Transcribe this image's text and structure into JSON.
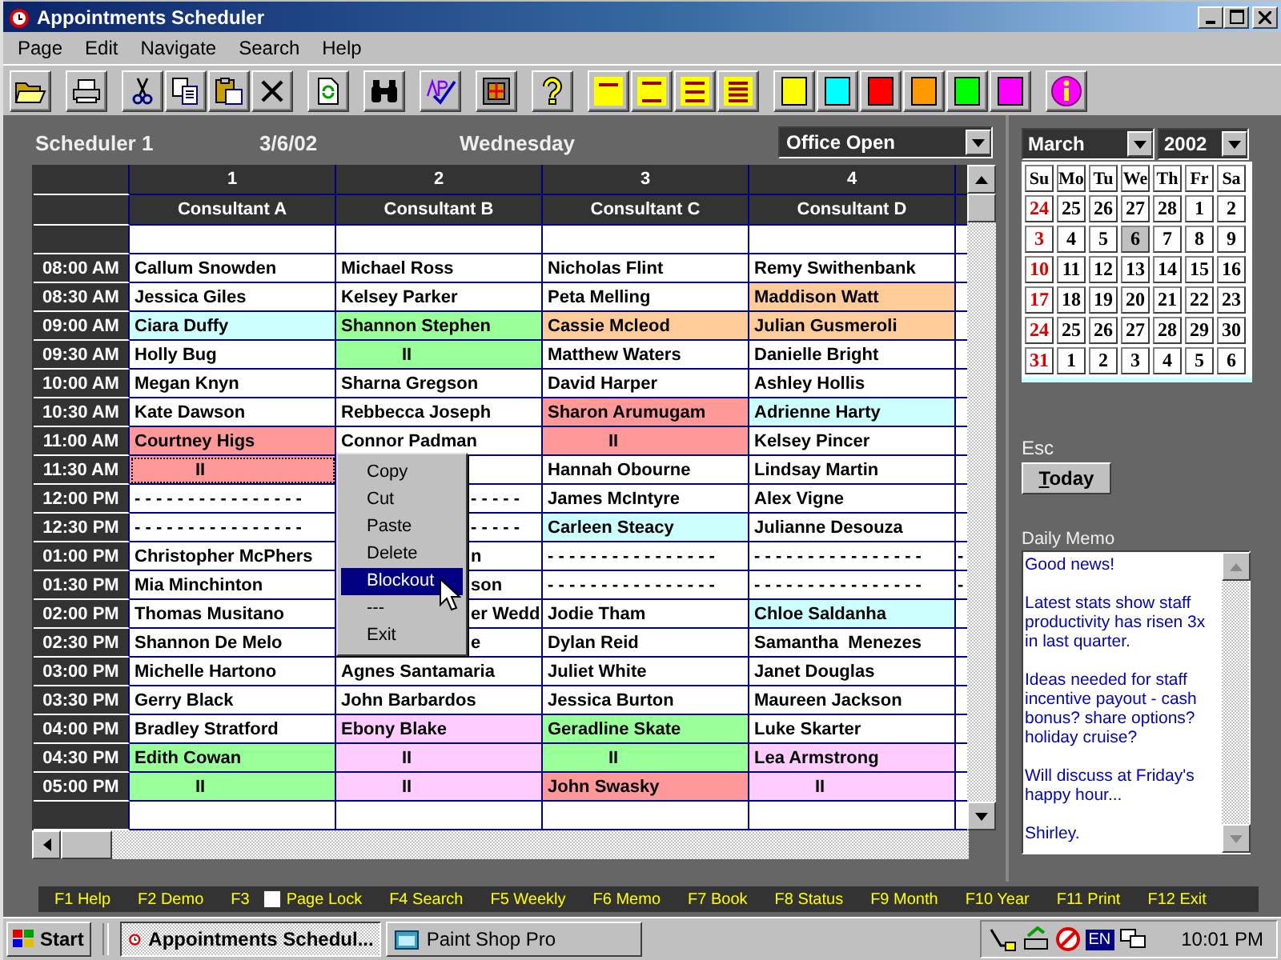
{
  "window": {
    "title": "Appointments Scheduler"
  },
  "menu": [
    "Page",
    "Edit",
    "Navigate",
    "Search",
    "Help"
  ],
  "toolbar": [
    [
      {
        "kind": "open"
      }
    ],
    [
      {
        "kind": "print"
      }
    ],
    [
      {
        "kind": "cut"
      },
      {
        "kind": "copy"
      },
      {
        "kind": "paste"
      },
      {
        "kind": "delete"
      }
    ],
    [
      {
        "kind": "refresh"
      }
    ],
    [
      {
        "kind": "find"
      }
    ],
    [
      {
        "kind": "spelling"
      }
    ],
    [
      {
        "kind": "layout"
      }
    ],
    [
      {
        "kind": "help"
      }
    ],
    [
      {
        "kind": "single"
      },
      {
        "kind": "double"
      },
      {
        "kind": "triple"
      },
      {
        "kind": "quadruple"
      }
    ],
    [
      {
        "kind": "color",
        "color": "#ffff00"
      },
      {
        "kind": "color",
        "color": "#00ffff"
      },
      {
        "kind": "color",
        "color": "#ff0000"
      },
      {
        "kind": "color",
        "color": "#ff9900"
      },
      {
        "kind": "color",
        "color": "#00ff00"
      },
      {
        "kind": "color",
        "color": "#ff00ff"
      }
    ],
    [
      {
        "kind": "info"
      }
    ]
  ],
  "scheduler": {
    "title": "Scheduler 1",
    "date": "3/6/02",
    "weekday": "Wednesday",
    "status_select": "Office Open"
  },
  "table": {
    "numbers": [
      "1",
      "2",
      "3",
      "4"
    ],
    "columns": [
      "Consultant A",
      "Consultant B",
      "Consultant C",
      "Consultant D"
    ],
    "rows": [
      {
        "cells": [
          {
            "selected": false
          },
          {
            "selected": false
          },
          {
            "selected": false
          },
          {
            "selected": false
          },
          {
            "selected": false
          }
        ]
      },
      {
        "time": "08:00 AM",
        "cells": [
          {
            "text": "Callum Snowden",
            "selected": false
          },
          {
            "text": "Michael Ross",
            "selected": false
          },
          {
            "text": "Nicholas Flint",
            "selected": false
          },
          {
            "text": "Remy Swithenbank",
            "selected": false
          },
          {
            "selected": false
          }
        ]
      },
      {
        "time": "08:30 AM",
        "cells": [
          {
            "text": "Jessica Giles",
            "selected": false
          },
          {
            "text": "Kelsey Parker",
            "selected": false
          },
          {
            "text": "Peta Melling",
            "selected": false
          },
          {
            "text": "Maddison Watt",
            "color": "#ffcc99",
            "selected": false
          },
          {
            "selected": false
          }
        ]
      },
      {
        "time": "09:00 AM",
        "cells": [
          {
            "text": "Ciara Duffy",
            "color": "#ccffff",
            "selected": false
          },
          {
            "text": "Shannon Stephen",
            "color": "#99ff99",
            "selected": false
          },
          {
            "text": "Cassie Mcleod",
            "color": "#ffcc99",
            "selected": false
          },
          {
            "text": "Julian Gusmeroli",
            "color": "#ffcc99",
            "selected": false
          },
          {
            "selected": false
          }
        ]
      },
      {
        "time": "09:30 AM",
        "cells": [
          {
            "text": "Holly Bug",
            "selected": false
          },
          {
            "kind": "continued",
            "text": "II",
            "color": "#99ff99",
            "selected": false
          },
          {
            "text": "Matthew Waters",
            "selected": false
          },
          {
            "text": "Danielle Bright",
            "selected": false
          },
          {
            "selected": false
          }
        ]
      },
      {
        "time": "10:00 AM",
        "cells": [
          {
            "text": "Megan Knyn",
            "selected": false
          },
          {
            "text": "Sharna Gregson",
            "selected": false
          },
          {
            "text": "David Harper",
            "selected": false
          },
          {
            "text": "Ashley Hollis",
            "selected": false
          },
          {
            "selected": false
          }
        ]
      },
      {
        "time": "10:30 AM",
        "cells": [
          {
            "text": "Kate Dawson",
            "selected": false
          },
          {
            "text": "Rebbecca Joseph",
            "selected": false
          },
          {
            "text": "Sharon Arumugam",
            "color": "#ff9999",
            "selected": false
          },
          {
            "text": "Adrienne Harty",
            "color": "#ccffff",
            "selected": false
          },
          {
            "selected": false
          }
        ]
      },
      {
        "time": "11:00 AM",
        "cells": [
          {
            "text": "Courtney Higs",
            "color": "#ff9999",
            "selected": false
          },
          {
            "text": "Connor Padman",
            "selected": false
          },
          {
            "kind": "continued",
            "text": "II",
            "color": "#ff9999",
            "selected": false
          },
          {
            "text": "Kelsey Pincer",
            "selected": false
          },
          {
            "selected": false
          }
        ]
      },
      {
        "time": "11:30 AM",
        "cells": [
          {
            "kind": "continued",
            "text": "II",
            "color": "#ff9999",
            "selected": true
          },
          {
            "selected": false
          },
          {
            "text": "Hannah Obourne",
            "selected": false
          },
          {
            "text": "Lindsay Martin",
            "selected": false
          },
          {
            "selected": false
          }
        ]
      },
      {
        "time": "12:00 PM",
        "cells": [
          {
            "text": "- - - - - - - - - - - - - - - -",
            "selected": false
          },
          {
            "kind": "partial",
            "text": "- - - - -",
            "selected": false
          },
          {
            "text": "James McIntyre",
            "selected": false
          },
          {
            "text": "Alex Vigne",
            "selected": false
          },
          {
            "selected": false
          }
        ]
      },
      {
        "time": "12:30 PM",
        "cells": [
          {
            "text": "- - - - - - - - - - - - - - - -",
            "selected": false
          },
          {
            "kind": "partial",
            "text": "- - - - -",
            "selected": false
          },
          {
            "text": "Carleen Steacy",
            "color": "#ccffff",
            "selected": false
          },
          {
            "text": "Julianne Desouza",
            "selected": false
          },
          {
            "selected": false
          }
        ]
      },
      {
        "time": "01:00 PM",
        "cells": [
          {
            "text": "Christopher McPhers",
            "selected": false
          },
          {
            "kind": "partial",
            "text": "n",
            "selected": false
          },
          {
            "text": "- - - - - - - - - - - - - - - -",
            "selected": false
          },
          {
            "text": "- - - - - - - - - - - - - - - -",
            "selected": false
          },
          {
            "text": "-",
            "selected": false
          }
        ]
      },
      {
        "time": "01:30 PM",
        "cells": [
          {
            "text": "Mia Minchinton",
            "selected": false
          },
          {
            "kind": "partial",
            "text": "son",
            "selected": false
          },
          {
            "text": "- - - - - - - - - - - - - - - -",
            "selected": false
          },
          {
            "text": "- - - - - - - - - - - - - - - -",
            "selected": false
          },
          {
            "text": "-",
            "selected": false
          }
        ]
      },
      {
        "time": "02:00 PM",
        "cells": [
          {
            "text": "Thomas Musitano",
            "selected": false
          },
          {
            "kind": "partial",
            "text": "er Wedd",
            "selected": false
          },
          {
            "text": "Jodie Tham",
            "selected": false
          },
          {
            "text": "Chloe Saldanha",
            "color": "#ccffff",
            "selected": false
          },
          {
            "selected": false
          }
        ]
      },
      {
        "time": "02:30 PM",
        "cells": [
          {
            "text": "Shannon De Melo",
            "selected": false
          },
          {
            "kind": "partial",
            "text": "e",
            "selected": false
          },
          {
            "text": "Dylan Reid",
            "selected": false
          },
          {
            "text": "Samantha  Menezes",
            "selected": false
          },
          {
            "selected": false
          }
        ]
      },
      {
        "time": "03:00 PM",
        "cells": [
          {
            "text": "Michelle Hartono",
            "selected": false
          },
          {
            "text": "Agnes Santamaria",
            "selected": false
          },
          {
            "text": "Juliet White",
            "selected": false
          },
          {
            "text": "Janet Douglas",
            "selected": false
          },
          {
            "selected": false
          }
        ]
      },
      {
        "time": "03:30 PM",
        "cells": [
          {
            "text": "Gerry Black",
            "selected": false
          },
          {
            "text": "John Barbardos",
            "selected": false
          },
          {
            "text": "Jessica Burton",
            "selected": false
          },
          {
            "text": "Maureen Jackson",
            "selected": false
          },
          {
            "selected": false
          }
        ]
      },
      {
        "time": "04:00 PM",
        "cells": [
          {
            "text": "Bradley Stratford",
            "selected": false
          },
          {
            "text": "Ebony Blake",
            "color": "#ffccff",
            "selected": false
          },
          {
            "text": "Geradline Skate",
            "color": "#99ff99",
            "selected": false
          },
          {
            "text": "Luke Skarter",
            "selected": false
          },
          {
            "selected": false
          }
        ]
      },
      {
        "time": "04:30 PM",
        "cells": [
          {
            "text": "Edith Cowan",
            "color": "#99ff99",
            "selected": false
          },
          {
            "kind": "continued",
            "text": "II",
            "color": "#ffccff",
            "selected": false
          },
          {
            "kind": "continued",
            "text": "II",
            "color": "#99ff99",
            "selected": false
          },
          {
            "text": "Lea Armstrong",
            "color": "#ffccff",
            "selected": false
          },
          {
            "selected": false
          }
        ]
      },
      {
        "time": "05:00 PM",
        "cells": [
          {
            "kind": "continued",
            "text": "II",
            "color": "#99ff99",
            "selected": false
          },
          {
            "kind": "continued",
            "text": "II",
            "color": "#ffccff",
            "selected": false
          },
          {
            "text": "John Swasky",
            "color": "#ff9999",
            "selected": false
          },
          {
            "kind": "continued",
            "text": "II",
            "color": "#ffccff",
            "selected": false
          },
          {
            "selected": false
          }
        ]
      },
      {
        "cells": [
          {
            "selected": false
          },
          {
            "selected": false
          },
          {
            "selected": false
          },
          {
            "selected": false
          },
          {
            "selected": false
          }
        ]
      }
    ]
  },
  "context_menu": [
    {
      "label": "Copy",
      "selected": false
    },
    {
      "label": "Cut",
      "selected": false
    },
    {
      "label": "Paste",
      "selected": false
    },
    {
      "label": "Delete",
      "selected": false
    },
    {
      "label": "Blockout",
      "selected": true
    },
    {
      "label": "---",
      "selected": false
    },
    {
      "label": "Exit",
      "selected": false
    }
  ],
  "calendar": {
    "month": "March",
    "year": "2002",
    "weekdays": [
      "Su",
      "Mo",
      "Tu",
      "We",
      "Th",
      "Fr",
      "Sa"
    ],
    "weeks": [
      [
        {
          "day": "24",
          "selected": false
        },
        {
          "day": "25",
          "selected": false
        },
        {
          "day": "26",
          "selected": false
        },
        {
          "day": "27",
          "selected": false
        },
        {
          "day": "28",
          "selected": false
        },
        {
          "day": "1",
          "selected": false
        },
        {
          "day": "2",
          "selected": false
        }
      ],
      [
        {
          "day": "3",
          "selected": false
        },
        {
          "day": "4",
          "selected": false
        },
        {
          "day": "5",
          "selected": false
        },
        {
          "day": "6",
          "selected": true
        },
        {
          "day": "7",
          "selected": false
        },
        {
          "day": "8",
          "selected": false
        },
        {
          "day": "9",
          "selected": false
        }
      ],
      [
        {
          "day": "10",
          "selected": false
        },
        {
          "day": "11",
          "selected": false
        },
        {
          "day": "12",
          "selected": false
        },
        {
          "day": "13",
          "selected": false
        },
        {
          "day": "14",
          "selected": false
        },
        {
          "day": "15",
          "selected": false
        },
        {
          "day": "16",
          "selected": false
        }
      ],
      [
        {
          "day": "17",
          "selected": false
        },
        {
          "day": "18",
          "selected": false
        },
        {
          "day": "19",
          "selected": false
        },
        {
          "day": "20",
          "selected": false
        },
        {
          "day": "21",
          "selected": false
        },
        {
          "day": "22",
          "selected": false
        },
        {
          "day": "23",
          "selected": false
        }
      ],
      [
        {
          "day": "24",
          "selected": false
        },
        {
          "day": "25",
          "selected": false
        },
        {
          "day": "26",
          "selected": false
        },
        {
          "day": "27",
          "selected": false
        },
        {
          "day": "28",
          "selected": false
        },
        {
          "day": "29",
          "selected": false
        },
        {
          "day": "30",
          "selected": false
        }
      ],
      [
        {
          "day": "31",
          "selected": false
        },
        {
          "day": "1",
          "selected": false
        },
        {
          "day": "2",
          "selected": false
        },
        {
          "day": "3",
          "selected": false
        },
        {
          "day": "4",
          "selected": false
        },
        {
          "day": "5",
          "selected": false
        },
        {
          "day": "6",
          "selected": false
        }
      ]
    ]
  },
  "esc_label": "Esc",
  "today_button": "Today",
  "memo": {
    "label": "Daily Memo",
    "paragraphs": [
      "Good news!",
      "Latest stats show staff productivity has risen 3x in last quarter.",
      "Ideas needed for staff incentive payout - cash bonus? share options? holiday cruise?",
      "Will discuss at Friday's happy hour...",
      "Shirley."
    ]
  },
  "function_keys": [
    {
      "kind": "key",
      "label": "F1 Help"
    },
    {
      "kind": "key",
      "label": "F2 Demo"
    },
    {
      "kind": "key",
      "label": "F3"
    },
    {
      "kind": "checkbox",
      "label": "Page Lock",
      "checked": false
    },
    {
      "kind": "key",
      "label": "F4 Search"
    },
    {
      "kind": "key",
      "label": "F5 Weekly"
    },
    {
      "kind": "key",
      "label": "F6 Memo"
    },
    {
      "kind": "key",
      "label": "F7 Book"
    },
    {
      "kind": "key",
      "label": "F8 Status"
    },
    {
      "kind": "key",
      "label": "F9 Month"
    },
    {
      "kind": "key",
      "label": "F10 Year"
    },
    {
      "kind": "key",
      "label": "F11 Print"
    },
    {
      "kind": "key",
      "label": "F12 Exit"
    }
  ],
  "taskbar": {
    "start": "Start",
    "tasks": [
      {
        "label": "Appointments Schedul...",
        "selected": true
      },
      {
        "label": "Paint Shop Pro",
        "selected": false
      }
    ],
    "language": "EN",
    "clock": "10:01 PM"
  }
}
